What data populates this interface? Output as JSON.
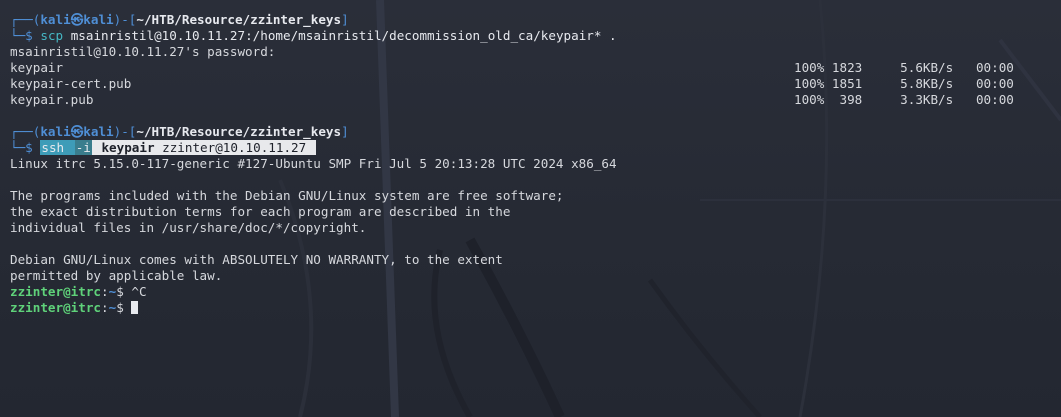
{
  "prompt1": {
    "box_top": "┌──(",
    "user": "kali",
    "at": "㉿",
    "host": "kali",
    "sep": ")-[",
    "cwd": "~/HTB/Resource/zzinter_keys",
    "end": "]",
    "box_bottom": "└─",
    "dollar": "$",
    "cmd": "scp",
    "args": " msainristil@10.10.11.27:/home/msainristil/decommission_old_ca/keypair* ."
  },
  "scp": {
    "password_prompt": "msainristil@10.10.11.27's password:",
    "files": [
      {
        "name": "keypair",
        "stats": "100% 1823     5.6KB/s   00:00"
      },
      {
        "name": "keypair-cert.pub",
        "stats": "100% 1851     5.8KB/s   00:00"
      },
      {
        "name": "keypair.pub",
        "stats": "100%  398     3.3KB/s   00:00"
      }
    ]
  },
  "prompt2": {
    "box_top": "┌──(",
    "user": "kali",
    "at": "㉿",
    "host": "kali",
    "sep": ")-[",
    "cwd": "~/HTB/Resource/zzinter_keys",
    "end": "]",
    "box_bottom": "└─",
    "dollar": "$",
    "cmd": "ssh",
    "flag": "-i",
    "key": "keypair",
    "target": "zzinter@10.10.11.27"
  },
  "motd": {
    "uname": "Linux itrc 5.15.0-117-generic #127-Ubuntu SMP Fri Jul 5 20:13:28 UTC 2024 x86_64",
    "p1": [
      "The programs included with the Debian GNU/Linux system are free software;",
      "the exact distribution terms for each program are described in the",
      "individual files in /usr/share/doc/*/copyright."
    ],
    "p2": [
      "Debian GNU/Linux comes with ABSOLUTELY NO WARRANTY, to the extent",
      "permitted by applicable law."
    ]
  },
  "remote_prompts": [
    {
      "user": "zzinter@itrc",
      "colon": ":",
      "path": "~",
      "dollar": "$",
      "input": " ^C"
    },
    {
      "user": "zzinter@itrc",
      "colon": ":",
      "path": "~",
      "dollar": "$",
      "input": " "
    }
  ],
  "colors": {
    "background": "#262a35",
    "prompt_blue": "#4f8fd6",
    "command_cyan": "#45b7c4",
    "user_green": "#5fd27a",
    "text": "#d6d8dd"
  }
}
